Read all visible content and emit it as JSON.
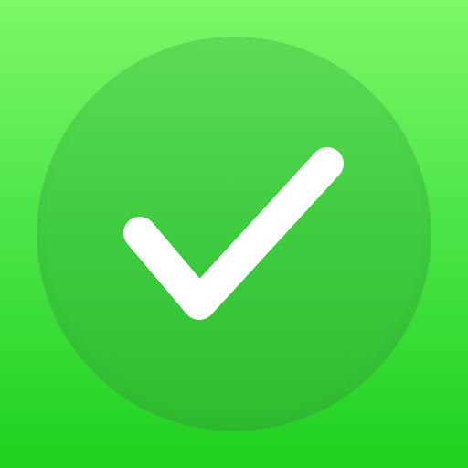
{
  "icon": {
    "name": "checkmark-icon",
    "colors": {
      "background_top": "#7ef866",
      "background_bottom": "#1fd11f",
      "badge_top": "#5ddc55",
      "badge_bottom": "#2ebd2f",
      "checkmark": "#ffffff"
    }
  }
}
